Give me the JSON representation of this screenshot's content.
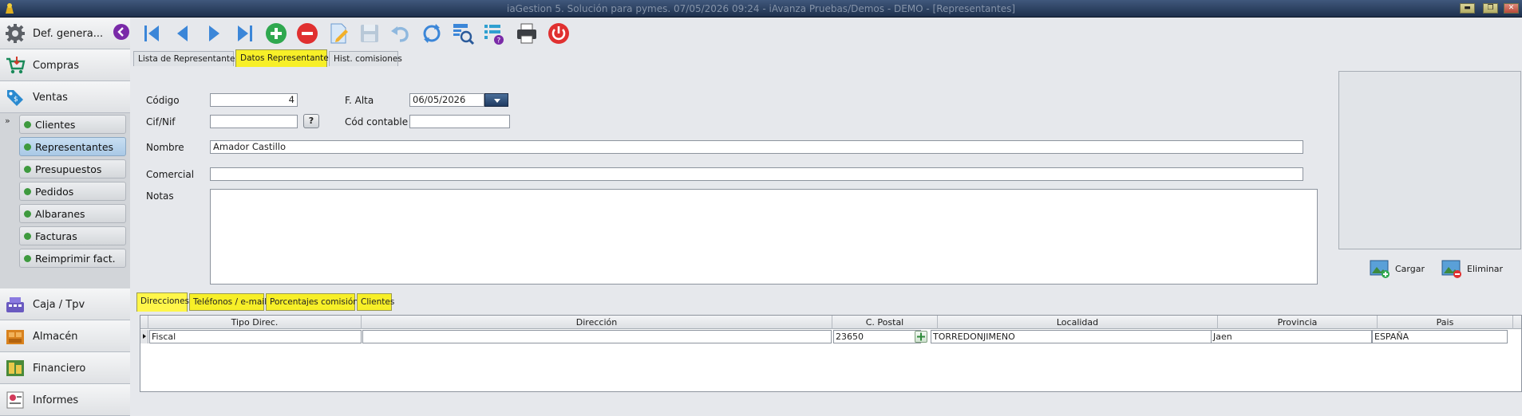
{
  "window": {
    "title": "iaGestion 5. Solución para pymes.  07/05/2026 09:24  -  iAvanza Pruebas/Demos - DEMO - [Representantes]",
    "controls": [
      "minimize-icon",
      "restore-icon",
      "close-icon"
    ]
  },
  "sidebar": {
    "modules_top": [
      {
        "label": "Def. genera...",
        "icon": "gear-icon"
      },
      {
        "label": "Compras",
        "icon": "cart-icon"
      },
      {
        "label": "Ventas",
        "icon": "sales-icon"
      }
    ],
    "collapse_icon": "»",
    "sub_items": [
      {
        "label": "Clientes",
        "active": false
      },
      {
        "label": "Representantes",
        "active": true
      },
      {
        "label": "Presupuestos",
        "active": false
      },
      {
        "label": "Pedidos",
        "active": false
      },
      {
        "label": "Albaranes",
        "active": false
      },
      {
        "label": "Facturas",
        "active": false
      },
      {
        "label": "Reimprimir fact.",
        "active": false
      }
    ],
    "modules_bottom": [
      {
        "label": "Caja / Tpv",
        "icon": "cash-register-icon"
      },
      {
        "label": "Almacén",
        "icon": "warehouse-icon"
      },
      {
        "label": "Financiero",
        "icon": "finance-icon"
      },
      {
        "label": "Informes",
        "icon": "reports-icon"
      }
    ]
  },
  "toolbar": {
    "buttons": [
      "back-icon",
      "first-record-icon",
      "previous-record-icon",
      "next-record-icon",
      "last-record-icon",
      "add-icon",
      "delete-icon",
      "edit-icon",
      "save-icon",
      "undo-icon",
      "refresh-icon",
      "search-icon",
      "list-help-icon",
      "print-icon",
      "power-icon"
    ]
  },
  "tabs": [
    {
      "label": "Lista de Representantes",
      "active": false
    },
    {
      "label": "Datos Representante",
      "active": true
    },
    {
      "label": "Hist. comisiones",
      "active": false
    }
  ],
  "form": {
    "codigo_label": "Código",
    "codigo_value": "4",
    "falta_label": "F. Alta",
    "falta_value": "06/05/2026",
    "cifnif_label": "Cif/Nif",
    "cifnif_value": "",
    "help_button": "?",
    "codcontable_label": "Cód contable",
    "codcontable_value": "",
    "nombre_label": "Nombre",
    "nombre_value": "Amador Castillo",
    "comercial_label": "Comercial",
    "comercial_value": "",
    "notas_label": "Notas",
    "notas_value": ""
  },
  "image_panel": {
    "load_label": "Cargar",
    "delete_label": "Eliminar"
  },
  "subtabs": [
    {
      "label": "Direcciones",
      "active": true
    },
    {
      "label": "Teléfonos / e-mail",
      "active": false
    },
    {
      "label": "Porcentajes comisión",
      "active": false
    },
    {
      "label": "Clientes",
      "active": false
    }
  ],
  "address_grid": {
    "columns": [
      "Tipo Direc.",
      "Dirección",
      "C. Postal",
      "Localidad",
      "Provincia",
      "Pais"
    ],
    "rows": [
      {
        "tipo": "Fiscal",
        "direccion": "",
        "cpostal": "23650",
        "localidad": "TORREDONJIMENO",
        "provincia": "Jaen",
        "pais": "ESPAÑA"
      }
    ]
  },
  "colors": {
    "highlight": "#f7ef28",
    "titlebar": "#1d2f4c",
    "toolbar_blue": "#2e7dd6",
    "add_green": "#2fa84f",
    "delete_red": "#e03030"
  }
}
